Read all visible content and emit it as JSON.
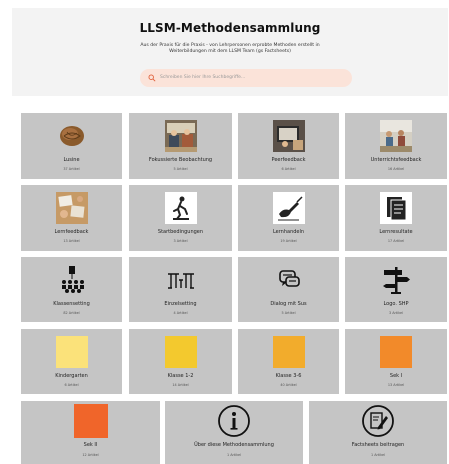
{
  "header": {
    "title": "LLSM-Methodensammlung",
    "subtitle": "Aus der Praxis für die Praxis - von Lehrpersonen erprobte Methoden erstellt in\nWeiterbildungen mit dem LLSM Team (gs Factsheets)",
    "search_placeholder": "Schreiben Sie hier Ihre Suchbegriffe..."
  },
  "colors": {
    "tile_bg": "#c5c5c5",
    "search_bg": "#fbe3d9",
    "kindergarten": "#fbe27a",
    "klasse12": "#f3c92e",
    "klasse36": "#f2ac2c",
    "seki": "#f28a2a",
    "sekii": "#f0652a"
  },
  "tiles": [
    {
      "label": "Lusine",
      "count": "37 Artikel",
      "icon": "walnut-photo"
    },
    {
      "label": "Fokussierte Beobachtung",
      "count": "5 Artikel",
      "icon": "classroom-photo"
    },
    {
      "label": "Peerfeedback",
      "count": "6 Artikel",
      "icon": "tablet-photo"
    },
    {
      "label": "Unterrichtsfeedback",
      "count": "16 Artikel",
      "icon": "classroom-photo"
    },
    {
      "label": "Lernfeedback",
      "count": "13 Artikel",
      "icon": "desk-photo"
    },
    {
      "label": "Startbedingungen",
      "count": "3 Artikel",
      "icon": "runner-icon"
    },
    {
      "label": "Lernhandeln",
      "count": "19 Artikel",
      "icon": "writing-hand-icon"
    },
    {
      "label": "Lernresultate",
      "count": "17 Artikel",
      "icon": "documents-icon"
    },
    {
      "label": "Klassensetting",
      "count": "82 Artikel",
      "icon": "group-icon"
    },
    {
      "label": "Einzelsetting",
      "count": "4 Artikel",
      "icon": "desks-icon"
    },
    {
      "label": "Dialog mit Sus",
      "count": "5 Artikel",
      "icon": "chat-icon"
    },
    {
      "label": "Logo. SHP",
      "count": "3 Artikel",
      "icon": "signpost-icon"
    },
    {
      "label": "Kindergarten",
      "count": "6 Artikel",
      "icon": "yellow-square"
    },
    {
      "label": "Klasse 1-2",
      "count": "14 Artikel",
      "icon": "yellow-square"
    },
    {
      "label": "Klasse 3-6",
      "count": "40 Artikel",
      "icon": "orange-square"
    },
    {
      "label": "Sek I",
      "count": "13 Artikel",
      "icon": "orange-square"
    },
    {
      "label": "Sek II",
      "count": "12 Artikel",
      "icon": "red-square"
    },
    {
      "label": "Über diese Methodensammlung",
      "count": "1 Artikel",
      "icon": "info-icon"
    },
    {
      "label": "Factsheets beitragen",
      "count": "1 Artikel",
      "icon": "edit-icon"
    }
  ]
}
